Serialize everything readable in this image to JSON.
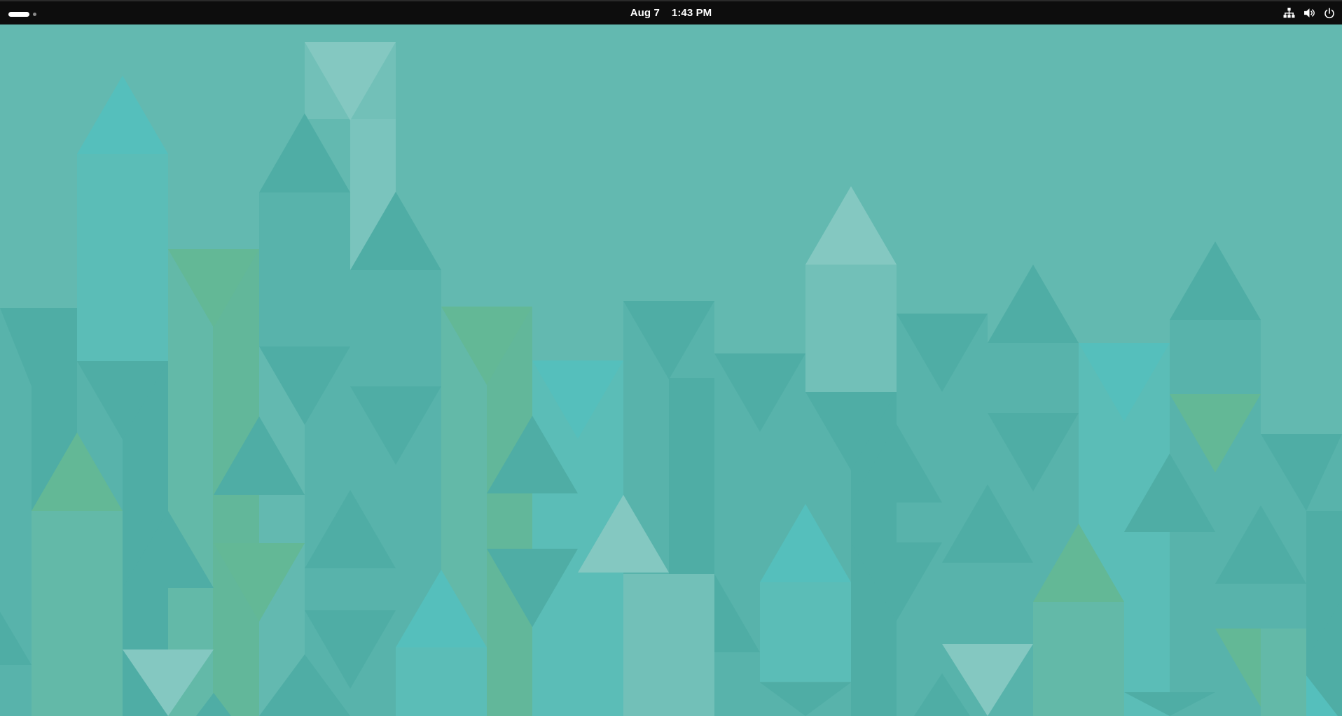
{
  "topbar": {
    "date": "Aug 7",
    "time": "1:43 PM",
    "icons": [
      "network-wired-icon",
      "volume-icon",
      "power-icon"
    ]
  },
  "desktop": {
    "wallpaper": "geometric-triangles",
    "colors": {
      "background": "#63b9b0",
      "dark": "#4fada5",
      "mid": "#58b3ab",
      "light": "#84c8c1",
      "cyan": "#55bfbc",
      "green": "#63b896",
      "pale": "#72c0b8"
    }
  }
}
